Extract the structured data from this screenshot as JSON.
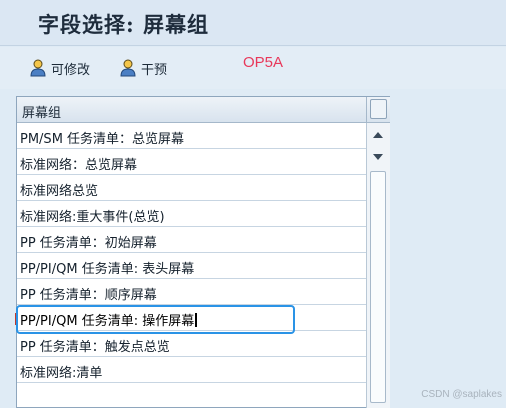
{
  "window": {
    "title": "字段选择: 屏幕组"
  },
  "toolbar": {
    "editable_label": "可修改",
    "dry_run_label": "干预",
    "editable_icon": "user-icon",
    "dry_run_icon": "user-icon"
  },
  "overlay_label": "OP5A",
  "table": {
    "header": "屏幕组",
    "rows": [
      "PM/SM 任务清单：总览屏幕",
      "标准网络：总览屏幕",
      "标准网络总览",
      "标准网络:重大事件(总览)",
      "PP 任务清单：初始屏幕",
      "PP/PI/QM 任务清单: 表头屏幕",
      "PP 任务清单：顺序屏幕",
      "PP/PI/QM 任务清单: 操作屏幕",
      "PP 任务清单：触发点总览",
      "标准网络:清单"
    ],
    "selected_row": 7
  },
  "watermark": "CSDN @saplakes",
  "colors": {
    "highlight_border": "#2a93e6",
    "overlay_text": "#e8385a",
    "background": "#dfebf5"
  }
}
